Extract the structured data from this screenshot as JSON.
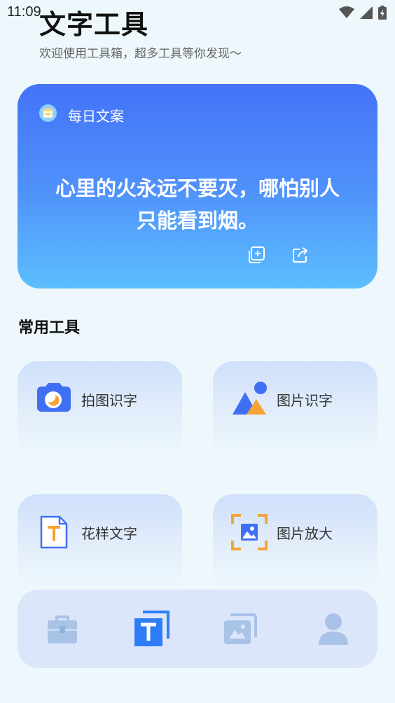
{
  "status_bar": {
    "time": "11:09"
  },
  "header": {
    "title": "文字工具",
    "subtitle": "欢迎使用工具箱，超多工具等你发现～"
  },
  "quote_card": {
    "title": "每日文案",
    "text_line1": "心里的火永远不要灭，哪怕别人",
    "text_line2": "只能看到烟。"
  },
  "section": {
    "title": "常用工具"
  },
  "tools": [
    {
      "label": "拍图识字",
      "icon": "camera-icon"
    },
    {
      "label": "图片识字",
      "icon": "image-mountain-icon"
    },
    {
      "label": "花样文字",
      "icon": "text-file-icon"
    },
    {
      "label": "图片放大",
      "icon": "image-enlarge-icon"
    }
  ],
  "bottom_nav": [
    {
      "name": "toolbox",
      "icon": "toolbox-icon",
      "active": false
    },
    {
      "name": "text",
      "icon": "text-icon",
      "active": true
    },
    {
      "name": "gallery",
      "icon": "gallery-icon",
      "active": false
    },
    {
      "name": "profile",
      "icon": "person-icon",
      "active": false
    }
  ],
  "colors": {
    "accent": "#2f7df6",
    "card_gradient_top": "#4473f8",
    "card_gradient_bottom": "#5cbefd",
    "nav_inactive": "#a9c3e6"
  }
}
